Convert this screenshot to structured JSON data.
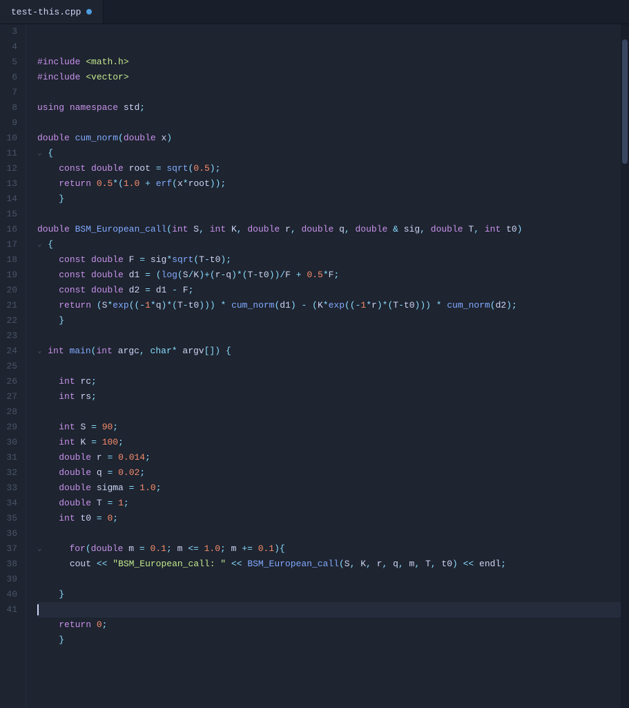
{
  "tab": {
    "label": "test-this.cpp",
    "modified": true,
    "dot_color": "#4e9de0"
  },
  "lines": [
    {
      "num": 3,
      "fold": "",
      "content": "<pp>#include</pp> <inc>&lt;math.h&gt;</inc>"
    },
    {
      "num": 4,
      "fold": "",
      "content": "<pp>#include</pp> <inc>&lt;vector&gt;</inc>"
    },
    {
      "num": 5,
      "fold": "",
      "content": ""
    },
    {
      "num": 6,
      "fold": "",
      "content": "<kw>using</kw> <kw>namespace</kw> <plain>std</plain><punct>;</punct>"
    },
    {
      "num": 7,
      "fold": "",
      "content": ""
    },
    {
      "num": 8,
      "fold": "",
      "content": "<kw>double</kw> <fn>cum_norm</fn><punct>(</punct><kw>double</kw> <plain>x</plain><punct>)</punct>"
    },
    {
      "num": 9,
      "fold": "v",
      "content": "<punct>{</punct>"
    },
    {
      "num": 10,
      "fold": "",
      "content": "    <kw>const</kw> <kw>double</kw> <plain>root</plain> <op>=</op> <fn>sqrt</fn><punct>(</punct><num>0.5</num><punct>);</punct>"
    },
    {
      "num": 11,
      "fold": "",
      "content": "    <kw>return</kw> <num>0.5</num><op>*</op><punct>(</punct><num>1.0</num> <op>+</op> <fn>erf</fn><punct>(</punct><plain>x</plain><op>*</op><plain>root</plain><punct>));</punct>"
    },
    {
      "num": 12,
      "fold": "",
      "content": "    <punct>}</punct>"
    },
    {
      "num": 13,
      "fold": "",
      "content": ""
    },
    {
      "num": 14,
      "fold": "",
      "content": "<kw>double</kw> <fn>BSM_European_call</fn><punct>(</punct><kw>int</kw> <plain>S</plain><punct>,</punct> <kw>int</kw> <plain>K</plain><punct>,</punct> <kw>double</kw> <plain>r</plain><punct>,</punct> <kw>double</kw> <plain>q</plain><punct>,</punct> <kw>double</kw> <op>&amp;</op> <plain>sig</plain><punct>,</punct> <kw>double</kw> <plain>T</plain><punct>,</punct> <kw>int</kw> <plain>t0</plain><punct>)</punct>"
    },
    {
      "num": 15,
      "fold": "v",
      "content": "<punct>{</punct>"
    },
    {
      "num": 16,
      "fold": "",
      "content": "    <kw>const</kw> <kw>double</kw> <plain>F</plain> <op>=</op> <plain>sig</plain><op>*</op><fn>sqrt</fn><punct>(</punct><plain>T</plain><op>-</op><plain>t0</plain><punct>);</punct>"
    },
    {
      "num": 17,
      "fold": "",
      "content": "    <kw>const</kw> <kw>double</kw> <plain>d1</plain> <op>=</op> <punct>(</punct><fn>log</fn><punct>(</punct><plain>S</plain><op>/</op><plain>K</plain><punct>)</punct><op>+</op><punct>(</punct><plain>r</plain><op>-</op><plain>q</plain><punct>)</punct><op>*</op><punct>(</punct><plain>T</plain><op>-</op><plain>t0</plain><punct>))</punct><op>/</op><plain>F</plain> <op>+</op> <num>0.5</num><op>*</op><plain>F</plain><punct>;</punct>"
    },
    {
      "num": 18,
      "fold": "",
      "content": "    <kw>const</kw> <kw>double</kw> <plain>d2</plain> <op>=</op> <plain>d1</plain> <op>-</op> <plain>F</plain><punct>;</punct>"
    },
    {
      "num": 19,
      "fold": "",
      "content": "    <kw>return</kw> <punct>(</punct><plain>S</plain><op>*</op><fn>exp</fn><punct>((</punct><op>-</op><num>1</num><op>*</op><plain>q</plain><punct>)</punct><op>*</op><punct>(</punct><plain>T</plain><op>-</op><plain>t0</plain><punct>)))</punct> <op>*</op> <fn>cum_norm</fn><punct>(</punct><plain>d1</plain><punct>)</punct> <op>-</op> <punct>(</punct><plain>K</plain><op>*</op><fn>exp</fn><punct>((</punct><op>-</op><num>1</num><op>*</op><plain>r</plain><punct>)</punct><op>*</op><punct>(</punct><plain>T</plain><op>-</op><plain>t0</plain><punct>)))</punct> <op>*</op> <fn>cum_norm</fn><punct>(</punct><plain>d2</plain><punct>);</punct>"
    },
    {
      "num": 20,
      "fold": "",
      "content": "    <punct>}</punct>"
    },
    {
      "num": 21,
      "fold": "",
      "content": ""
    },
    {
      "num": 22,
      "fold": "v",
      "content": "<kw>int</kw> <fn>main</fn><punct>(</punct><kw>int</kw> <plain>argc</plain><punct>,</punct> <kw2>char</kw2><op>*</op> <plain>argv</plain><punct>[])</punct> <punct>{</punct>"
    },
    {
      "num": 23,
      "fold": "",
      "content": ""
    },
    {
      "num": 24,
      "fold": "",
      "content": "    <kw>int</kw> <plain>rc</plain><punct>;</punct>"
    },
    {
      "num": 25,
      "fold": "",
      "content": "    <kw>int</kw> <plain>rs</plain><punct>;</punct>"
    },
    {
      "num": 26,
      "fold": "",
      "content": ""
    },
    {
      "num": 27,
      "fold": "",
      "content": "    <kw>int</kw> <plain>S</plain> <op>=</op> <num>90</num><punct>;</punct>"
    },
    {
      "num": 28,
      "fold": "",
      "content": "    <kw>int</kw> <plain>K</plain> <op>=</op> <num>100</num><punct>;</punct>"
    },
    {
      "num": 29,
      "fold": "",
      "content": "    <kw>double</kw> <plain>r</plain> <op>=</op> <num>0.014</num><punct>;</punct>"
    },
    {
      "num": 30,
      "fold": "",
      "content": "    <kw>double</kw> <plain>q</plain> <op>=</op> <num>0.02</num><punct>;</punct>"
    },
    {
      "num": 31,
      "fold": "",
      "content": "    <kw>double</kw> <plain>sigma</plain> <op>=</op> <num>1.0</num><punct>;</punct>"
    },
    {
      "num": 32,
      "fold": "",
      "content": "    <kw>double</kw> <plain>T</plain> <op>=</op> <num>1</num><punct>;</punct>"
    },
    {
      "num": 33,
      "fold": "",
      "content": "    <kw>int</kw> <plain>t0</plain> <op>=</op> <num>0</num><punct>;</punct>"
    },
    {
      "num": 34,
      "fold": "",
      "content": ""
    },
    {
      "num": 35,
      "fold": "v",
      "content": "    <kw>for</kw><punct>(</punct><kw>double</kw> <plain>m</plain> <op>=</op> <num>0.1</num><punct>;</punct> <plain>m</plain> <op>&lt;=</op> <num>1.0</num><punct>;</punct> <plain>m</plain> <op>+=</op> <num>0.1</num><punct>){</punct>"
    },
    {
      "num": 36,
      "fold": "",
      "content": "      <plain>cout</plain> <op>&lt;&lt;</op> <str>\"BSM_European_call: \"</str> <op>&lt;&lt;</op> <fn>BSM_European_call</fn><punct>(</punct><plain>S</plain><punct>,</punct> <plain>K</plain><punct>,</punct> <plain>r</plain><punct>,</punct> <plain>q</plain><punct>,</punct> <plain>m</plain><punct>,</punct> <plain>T</plain><punct>,</punct> <plain>t0</plain><punct>)</punct> <op>&lt;&lt;</op> <plain>endl</plain><punct>;</punct>"
    },
    {
      "num": 37,
      "fold": "",
      "content": ""
    },
    {
      "num": 38,
      "fold": "",
      "content": "    <punct>}</punct>"
    },
    {
      "num": 39,
      "fold": "",
      "content": "CURSOR"
    },
    {
      "num": 40,
      "fold": "",
      "content": "    <kw>return</kw> <num>0</num><punct>;</punct>"
    },
    {
      "num": 41,
      "fold": "",
      "content": "    <punct>}</punct>"
    }
  ]
}
